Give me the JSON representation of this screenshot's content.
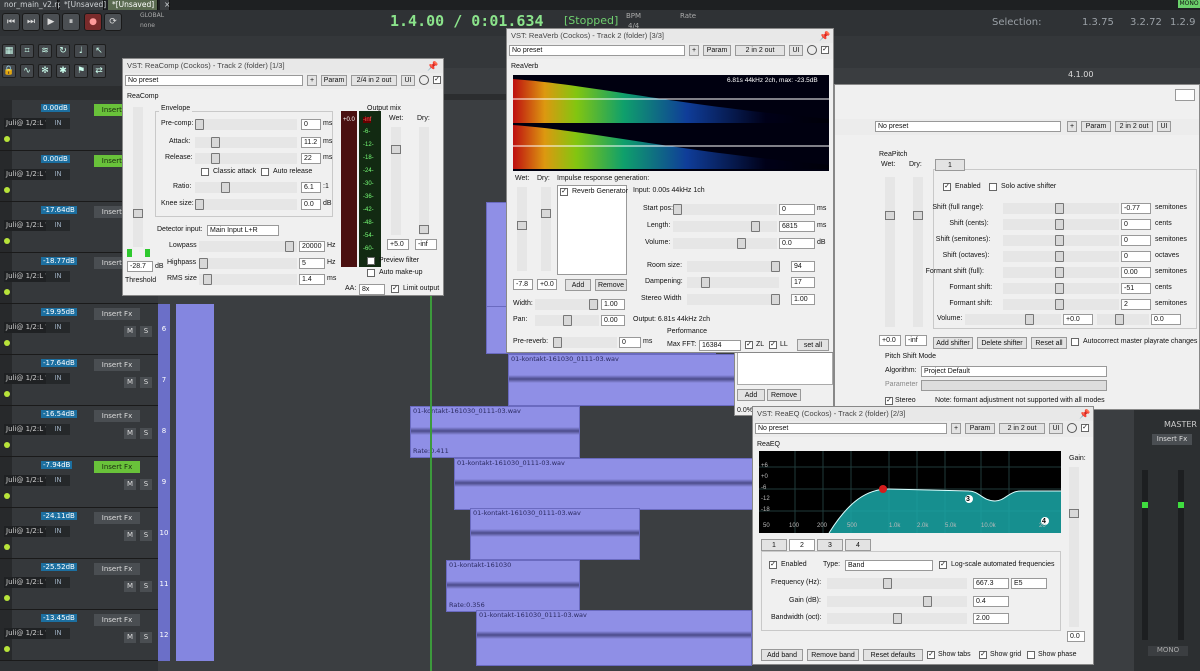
{
  "tabs": [
    "nor_main_v2.rpp",
    "*[Unsaved]",
    "*[Unsaved]"
  ],
  "transport": {
    "time": "1.4.00 / 0:01.634",
    "state": "[Stopped]",
    "bpm_label": "BPM",
    "rate_label": "Rate",
    "sig": "4/4",
    "global": "GLOBAL",
    "none": "none",
    "selection_label": "Selection:",
    "selection_start": "1.3.75",
    "selection_end": "3.2.72",
    "selection_len": "1.2.9",
    "mono": "MONO"
  },
  "ruler": {
    "marker": "4.1.00"
  },
  "tracks": [
    {
      "vol": "0.00dB",
      "route": "Juli@ 1/2:L ▼",
      "in": "IN",
      "fx": "Insert Fx",
      "fx_on": true,
      "num": ""
    },
    {
      "vol": "0.00dB",
      "route": "Juli@ 1/2:L ▼",
      "in": "IN",
      "fx": "Insert Fx",
      "fx_on": true,
      "num": ""
    },
    {
      "vol": "-17.64dB",
      "route": "Juli@ 1/2:L ▼",
      "in": "IN",
      "fx": "Insert Fx",
      "fx_on": false,
      "num": ""
    },
    {
      "vol": "-18.77dB",
      "route": "Juli@ 1/2:L ▼",
      "in": "IN",
      "fx": "Insert Fx",
      "fx_on": false,
      "num": ""
    },
    {
      "vol": "-19.95dB",
      "route": "Juli@ 1/2:L ▼",
      "in": "IN",
      "fx": "Insert Fx",
      "fx_on": false,
      "num": "6"
    },
    {
      "vol": "-17.64dB",
      "route": "Juli@ 1/2:L ▼",
      "in": "IN",
      "fx": "Insert Fx",
      "fx_on": false,
      "num": "7"
    },
    {
      "vol": "-16.54dB",
      "route": "Juli@ 1/2:L ▼",
      "in": "IN",
      "fx": "Insert Fx",
      "fx_on": false,
      "num": "8"
    },
    {
      "vol": "-7.94dB",
      "route": "Juli@ 1/2:L ▼",
      "in": "IN",
      "fx": "Insert Fx",
      "fx_on": true,
      "num": "9"
    },
    {
      "vol": "-24.11dB",
      "route": "Juli@ 1/2:L ▼",
      "in": "IN",
      "fx": "Insert Fx",
      "fx_on": false,
      "num": "10"
    },
    {
      "vol": "-25.52dB",
      "route": "Juli@ 1/2:L ▼",
      "in": "IN",
      "fx": "Insert Fx",
      "fx_on": false,
      "num": "11"
    },
    {
      "vol": "-13.45dB",
      "route": "Juli@ 1/2:L ▼",
      "in": "IN",
      "fx": "Insert Fx",
      "fx_on": false,
      "num": "12"
    }
  ],
  "items": [
    {
      "label": "01-kontakt-161030_0111-03.wav"
    },
    {
      "label": "01-kontakt-161030_0111-03.wav",
      "rate": "Rate:0.411"
    },
    {
      "label": "01-kontakt-161030_0111-03.wav"
    },
    {
      "label": "01-kontakt-161030_0111-03.wav"
    },
    {
      "label": "01-kontakt-161030",
      "rate": "Rate:0.356"
    },
    {
      "label": "01-kontakt-161030_0111-03.wav"
    }
  ],
  "master": {
    "label": "MASTER",
    "insert": "Insert Fx",
    "mono": "MONO"
  },
  "reacomp": {
    "title": "VST: ReaComp (Cockos) - Track 2 (folder) [1/3]",
    "preset": "No preset",
    "param": "Param",
    "io": "2/4 in 2 out",
    "ui": "UI",
    "name": "ReaComp",
    "envelope": "Envelope",
    "precomp": "Pre-comp:",
    "precomp_val": "0",
    "ms": "ms",
    "attack": "Attack:",
    "attack_val": "11.2",
    "release": "Release:",
    "release_val": "22",
    "classic": "Classic attack",
    "autorelease": "Auto release",
    "ratio": "Ratio:",
    "ratio_val": "6.1",
    "ratio_unit": ":1",
    "knee": "Knee size:",
    "knee_val": "0.0",
    "db": "dB",
    "detector": "Detector input:",
    "detector_val": "Main Input L+R",
    "lowpass": "Lowpass",
    "lowpass_val": "20000",
    "hz": "Hz",
    "highpass": "Highpass",
    "highpass_val": "5",
    "rms": "RMS size",
    "rms_val": "1.4",
    "threshold": "Threshold",
    "threshold_val": "-28.7",
    "outmix": "Output mix",
    "wet": "Wet:",
    "dry": "Dry:",
    "wet_val": "+5.0",
    "dry_val": "-inf",
    "preview": "Preview filter",
    "automakeup": "Auto make-up",
    "aa": "AA:",
    "aa_val": "8x",
    "limit": "Limit output",
    "meter_top": "+0.0",
    "meter_inf": "-inf",
    "scale": [
      "-6-",
      "-12-",
      "-18-",
      "-24-",
      "-30-",
      "-36-",
      "-42-",
      "-48-",
      "-54-",
      "-60-"
    ]
  },
  "reaverb": {
    "title": "VST: ReaVerb (Cockos) - Track 2 (folder) [3/3]",
    "preset": "No preset",
    "param": "Param",
    "io": "2 in 2 out",
    "ui": "UI",
    "name": "ReaVerb",
    "spectro_info": "6.81s 44kHz 2ch, max: -23.5dB",
    "wet": "Wet:",
    "dry": "Dry:",
    "irgen": "Impulse response generation:",
    "revgen": "Reverb Generator",
    "input": "Input: 0.00s 44kHz 1ch",
    "startpos": "Start pos:",
    "startpos_val": "0",
    "ms": "ms",
    "length": "Length:",
    "length_val": "6815",
    "volume": "Volume:",
    "volume_val": "0.0",
    "db": "dB",
    "roomsize": "Room size:",
    "roomsize_val": "94",
    "dampening": "Dampening:",
    "dampening_val": "17",
    "stereowidth": "Stereo Width",
    "stereowidth_val": "1.00",
    "wet_val": "-7.8",
    "dry_val": "+0.0",
    "add": "Add",
    "remove": "Remove",
    "width": "Width:",
    "width_val": "1.00",
    "pan": "Pan:",
    "pan_val": "0.00",
    "prereverb": "Pre-reverb:",
    "prereverb_val": "0",
    "output": "Output: 6.81s 44kHz 2ch",
    "perf": "Performance",
    "maxfft": "Max FFT:",
    "maxfft_val": "16384",
    "zl": "ZL",
    "ll": "LL",
    "setall": "set all"
  },
  "reapitch": {
    "preset": "No preset",
    "param": "Param",
    "io": "2 in 2 out",
    "ui": "UI",
    "name": "ReaPitch",
    "wet": "Wet:",
    "dry": "Dry:",
    "tab1": "1",
    "enabled": "Enabled",
    "solo": "Solo active shifter",
    "rows": [
      {
        "label": "Shift (full range):",
        "val": "-0.77",
        "unit": "semitones"
      },
      {
        "label": "Shift (cents):",
        "val": "0",
        "unit": "cents"
      },
      {
        "label": "Shift (semitones):",
        "val": "0",
        "unit": "semitones"
      },
      {
        "label": "Shift (octaves):",
        "val": "0",
        "unit": "octaves"
      },
      {
        "label": "Formant shift (full):",
        "val": "0.00",
        "unit": "semitones"
      },
      {
        "label": "Formant shift:",
        "val": "-51",
        "unit": "cents"
      },
      {
        "label": "Formant shift:",
        "val": "2",
        "unit": "semitones"
      }
    ],
    "volume": "Volume:",
    "volume_val": "+0.0",
    "pan_val": "0.0",
    "wet_val": "+0.0",
    "dry_val": "-inf",
    "addshifter": "Add shifter",
    "delshifter": "Delete shifter",
    "resetall": "Reset all",
    "autocorrect": "Autocorrect master playrate changes",
    "pitchmode": "Pitch Shift Mode",
    "algorithm": "Algorithm:",
    "algorithm_val": "Project Default",
    "parameter": "Parameter",
    "stereo": "Stereo",
    "note": "Note: formant adjustment not supported with all modes"
  },
  "hidden_win": {
    "add": "Add",
    "remove": "Remove",
    "pct": "0.0%"
  },
  "reaeq": {
    "title": "VST: ReaEQ (Cockos) - Track 2 (folder) [2/3]",
    "preset": "No preset",
    "param": "Param",
    "io": "2 in 2 out",
    "ui": "UI",
    "name": "ReaEQ",
    "gain": "Gain:",
    "gain_val": "0.0",
    "db_labels": [
      "+6",
      "+0",
      "-6",
      "-12",
      "-18"
    ],
    "freq_labels": [
      "50",
      "100",
      "200",
      "500",
      "1.0k",
      "2.0k",
      "5.0k",
      "10.0k",
      "20"
    ],
    "tabs": [
      "1",
      "2",
      "3",
      "4"
    ],
    "enabled": "Enabled",
    "type": "Type:",
    "type_val": "Band",
    "logscale": "Log-scale automated frequencies",
    "freq": "Frequency (Hz):",
    "freq_val": "667.3",
    "note_val": "E5",
    "gaindb": "Gain (dB):",
    "gaindb_val": "0.4",
    "bw": "Bandwidth (oct):",
    "bw_val": "2.00",
    "addband": "Add band",
    "removeband": "Remove band",
    "reset": "Reset defaults",
    "showtabs": "Show tabs",
    "showgrid": "Show grid",
    "showphase": "Show phase",
    "band_marks": [
      "3",
      "4"
    ]
  },
  "colors": {
    "accent_green": "#69c23a",
    "item": "#8f8fe6",
    "timecode": "#8be38b"
  }
}
